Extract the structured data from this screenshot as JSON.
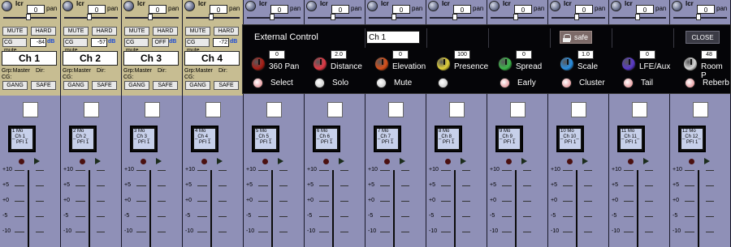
{
  "pan_label": "pan",
  "lcr_label": "lcr",
  "mute_label": "MUTE",
  "hard_label": "HARD",
  "cg_mute_label": "CG mute",
  "db_label": "dB",
  "gang_label": "GANG",
  "safe_label": "SAFE",
  "grp_label": "Grp:Master",
  "dir_label": "Dir:",
  "cg_label": "CG:",
  "scale_labels": [
    "+10",
    "+5",
    "+0",
    "-5",
    "-10"
  ],
  "strips": [
    {
      "name": "Ch 1",
      "pan": "0",
      "cg_value": "-84",
      "off_label": "",
      "disp": [
        "1  Mo",
        "_Ch 1_",
        "PFI 1"
      ]
    },
    {
      "name": "Ch 2",
      "pan": "0",
      "cg_value": "-57",
      "off_label": "",
      "disp": [
        "2  Mo",
        "_Ch 2_",
        "PFI 1"
      ]
    },
    {
      "name": "Ch 3",
      "pan": "0",
      "cg_value": "",
      "off_label": "OFF",
      "disp": [
        "3  Mo",
        "_Ch 3_",
        "PFI 1"
      ]
    },
    {
      "name": "Ch 4",
      "pan": "0",
      "cg_value": "-72",
      "off_label": "",
      "disp": [
        "4  Mo",
        "_Ch 4_",
        "PFI 1"
      ]
    },
    {
      "name": "",
      "pan": "0",
      "cg_value": "",
      "off_label": "",
      "disp": [
        "5  Mo",
        "_Ch 5_",
        "PFI 1"
      ]
    },
    {
      "name": "",
      "pan": "0",
      "cg_value": "",
      "off_label": "",
      "disp": [
        "6  Mo",
        "_Ch 6_",
        "PFI 1"
      ]
    },
    {
      "name": "",
      "pan": "0",
      "cg_value": "",
      "off_label": "",
      "disp": [
        "7  Mo",
        "_Ch 7_",
        "PFI 1"
      ]
    },
    {
      "name": "",
      "pan": "0",
      "cg_value": "",
      "off_label": "",
      "disp": [
        "8  Mo",
        "_Ch 8_",
        "PFI 1"
      ]
    },
    {
      "name": "",
      "pan": "0",
      "cg_value": "",
      "off_label": "",
      "disp": [
        "9  Mo",
        "_Ch 9_",
        "PFI 1"
      ]
    },
    {
      "name": "",
      "pan": "0",
      "cg_value": "",
      "off_label": "",
      "disp": [
        "10 Mo",
        "_Ch 10_",
        "PFI 1"
      ]
    },
    {
      "name": "",
      "pan": "0",
      "cg_value": "",
      "off_label": "",
      "disp": [
        "11 Mo",
        "_Ch 11_",
        "PFI 1"
      ]
    },
    {
      "name": "",
      "pan": "0",
      "cg_value": "",
      "off_label": "",
      "disp": [
        "12 Mo",
        "_Ch 12_",
        "PFI 1"
      ]
    }
  ],
  "external_control": {
    "title": "External Control",
    "channel": "Ch 1",
    "safe_label": "safe",
    "close_label": "CLOSE",
    "params": [
      {
        "label": "360 Pan",
        "value": "0",
        "color": "#a81f17",
        "bottom": "Select",
        "radio_color": "#e8a0a4"
      },
      {
        "label": "Distance",
        "value": "2.0",
        "color": "#e03a46",
        "bottom": "Solo",
        "radio_color": "#cfcfcf"
      },
      {
        "label": "Elevation",
        "value": "0",
        "color": "#d8501a",
        "bottom": "Mute",
        "radio_color": "#cfcfcf"
      },
      {
        "label": "Presence",
        "value": "100",
        "color": "#e3d23a",
        "bottom": "",
        "radio_color": "#cfcfcf"
      },
      {
        "label": "Spread",
        "value": "0",
        "color": "#3cb84a",
        "bottom": "Early",
        "radio_color": "#e8a0a4"
      },
      {
        "label": "Scale",
        "value": "1.0",
        "color": "#2a8ee0",
        "bottom": "Cluster",
        "radio_color": "#e8a0a4"
      },
      {
        "label": "LFE/Aux",
        "value": "0",
        "color": "#5a3ac8",
        "bottom": "Tail",
        "radio_color": "#e8a0a4"
      },
      {
        "label": "Room P",
        "value": "48",
        "color": "#d8d8d8",
        "bottom": "Reberb",
        "radio_color": "#e8a0a4"
      }
    ]
  }
}
